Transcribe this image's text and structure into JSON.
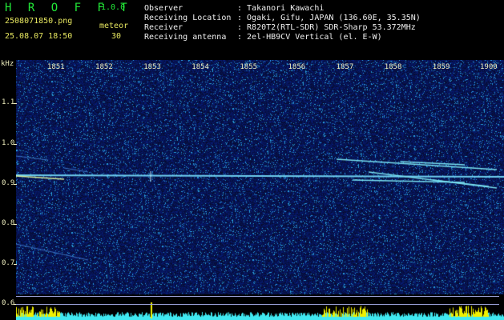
{
  "app": {
    "name": "H R O F F T",
    "version": "1.0.0"
  },
  "file": {
    "name": "2508071850.png",
    "datetime": "25.08.07 18:50"
  },
  "meteor": {
    "label": "meteor",
    "count": "30"
  },
  "info": {
    "observer_label": "Observer",
    "observer_value": ": Takanori Kawachi",
    "location_label": "Receiving Location",
    "location_value": ": Ogaki, Gifu, JAPAN (136.60E, 35.35N)",
    "receiver_label": "Receiver",
    "receiver_value": ": R820T2(RTL-SDR) SDR-Sharp 53.372MHz",
    "antenna_label": "Receiving antenna",
    "antenna_value": ": 2el-HB9CV Vertical (el. E-W)"
  },
  "axis": {
    "y_unit": "kHz",
    "y_ticks": [
      "1.1",
      "1.0",
      "0.9",
      "0.8",
      "0.7",
      "0.6"
    ],
    "x_ticks": [
      "1851",
      "1852",
      "1853",
      "1854",
      "1855",
      "1856",
      "1857",
      "1858",
      "1859",
      "1900"
    ]
  },
  "colors": {
    "background": "#000000",
    "spectrogram": "#070a3a",
    "header_green": "#22e838",
    "header_yellow": "#e8e860",
    "signal_cyan": "#40e8f0",
    "signal_yellow": "#f0f000"
  }
}
